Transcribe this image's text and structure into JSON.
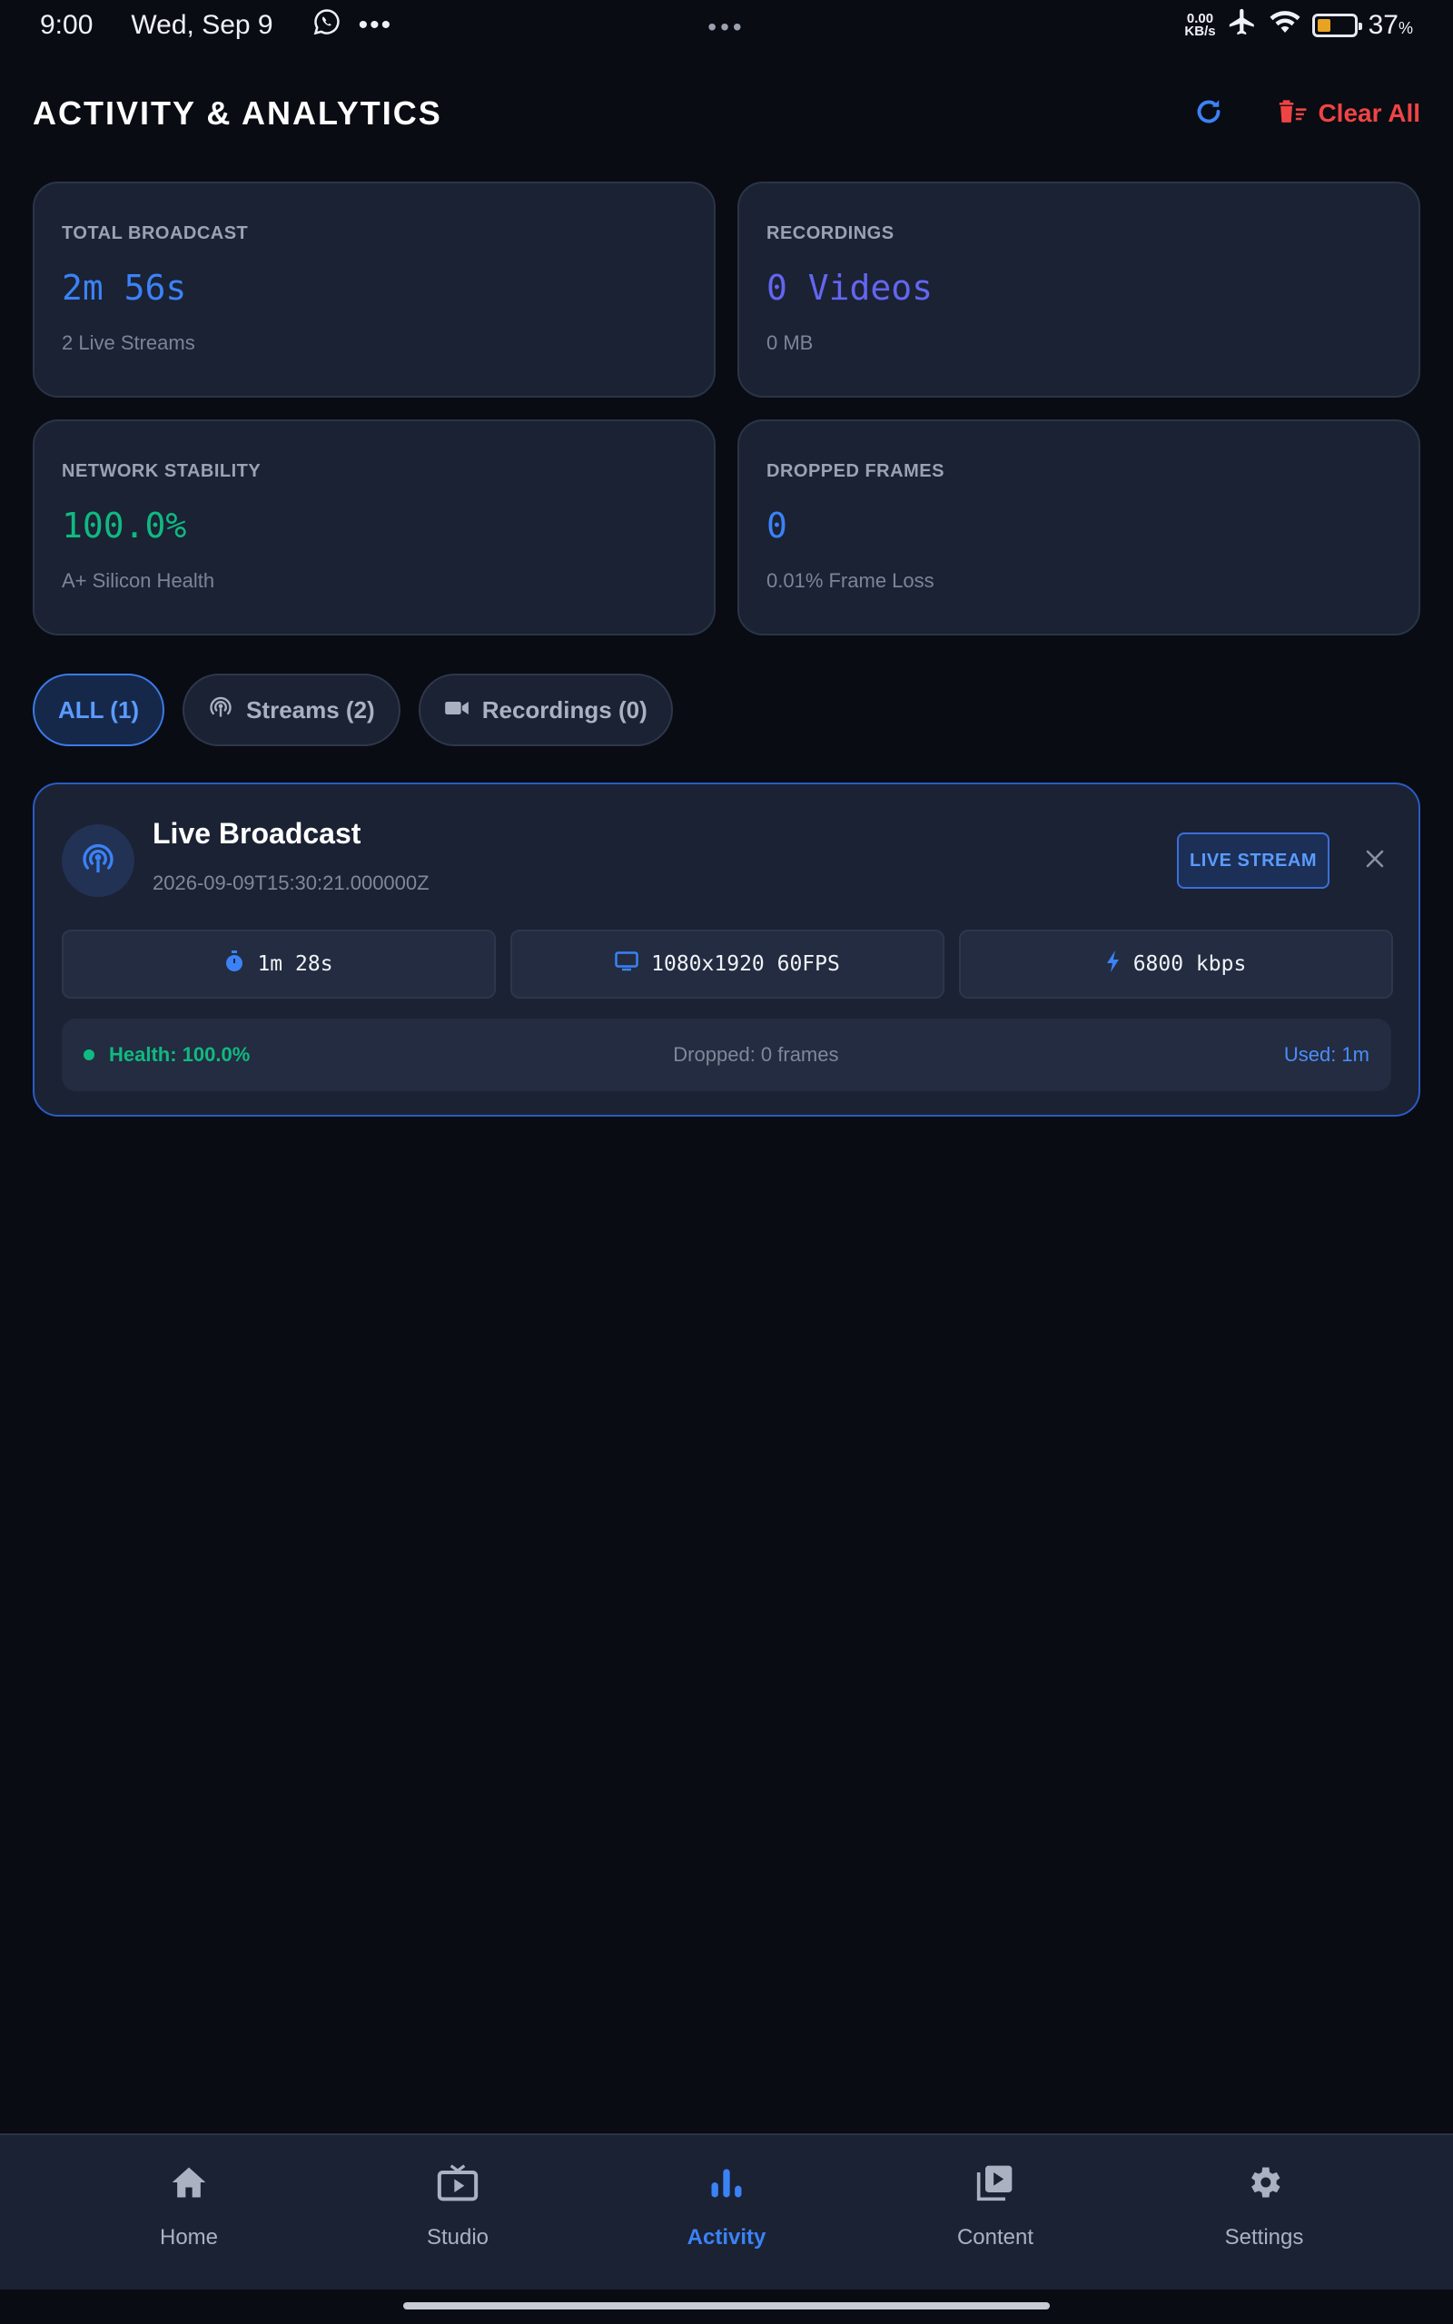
{
  "status_bar": {
    "time": "9:00",
    "date": "Wed, Sep 9",
    "net_speed_value": "0.00",
    "net_speed_unit": "KB/s",
    "battery_percent": "37",
    "battery_unit": "%"
  },
  "header": {
    "title": "ACTIVITY & ANALYTICS",
    "clear_all_label": "Clear All"
  },
  "stats": {
    "total_broadcast": {
      "label": "TOTAL BROADCAST",
      "value": "2m 56s",
      "sub": "2 Live Streams",
      "color": "#3b82f6"
    },
    "recordings": {
      "label": "RECORDINGS",
      "value": "0 Videos",
      "sub": "0 MB",
      "color": "#6366f1"
    },
    "network_stability": {
      "label": "NETWORK STABILITY",
      "value": "100.0%",
      "sub": "A+ Silicon Health",
      "color": "#10b981"
    },
    "dropped_frames": {
      "label": "DROPPED FRAMES",
      "value": "0",
      "sub": "0.01% Frame Loss",
      "color": "#3b82f6"
    }
  },
  "filters": [
    {
      "label": "ALL (1)",
      "active": true
    },
    {
      "label": "Streams (2)",
      "icon": "broadcast-icon"
    },
    {
      "label": "Recordings (0)",
      "icon": "video-camera-icon"
    }
  ],
  "activity": {
    "title": "Live Broadcast",
    "timestamp": "2026-09-09T15:30:21.000000Z",
    "badge": "LIVE STREAM",
    "metrics": {
      "duration": "1m 28s",
      "resolution": "1080x1920 60FPS",
      "bitrate": "6800 kbps"
    },
    "health": "Health: 100.0%",
    "dropped": "Dropped: 0 frames",
    "used": "Used: 1m"
  },
  "nav": {
    "home": "Home",
    "studio": "Studio",
    "activity": "Activity",
    "content": "Content",
    "settings": "Settings",
    "active": "activity",
    "accent": "#3b82f6"
  }
}
